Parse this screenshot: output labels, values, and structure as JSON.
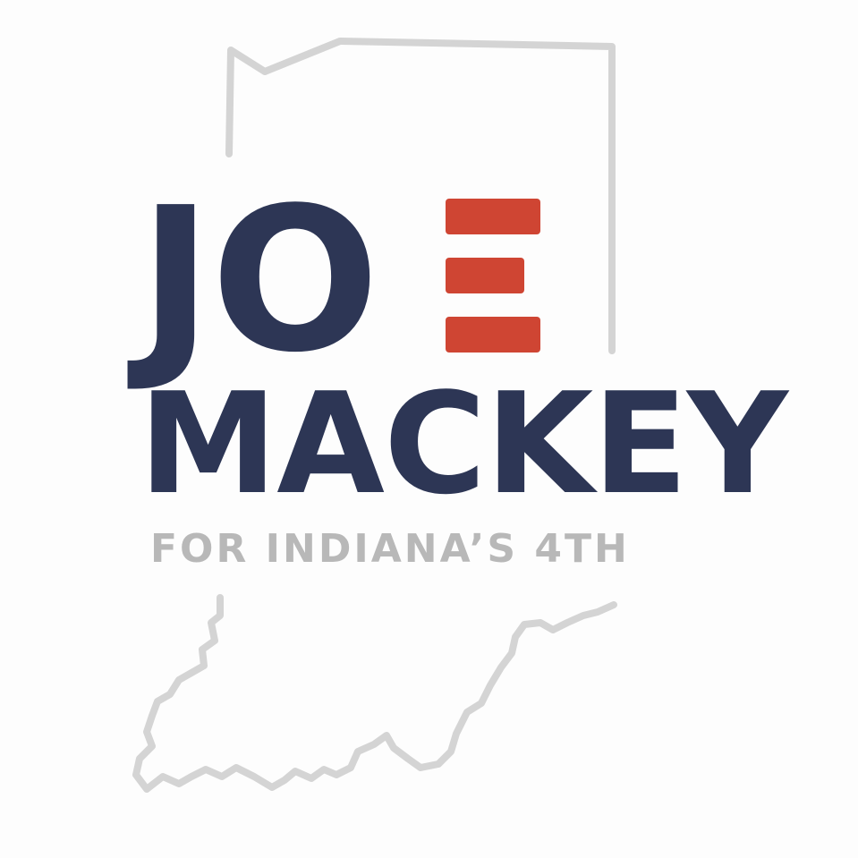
{
  "logo": {
    "first_name_letters": "JO",
    "first_name_full": "JOE",
    "last_name": "MACKEY",
    "tagline": "FOR INDIANA’S 4TH"
  },
  "icons": {
    "state_outline": "indiana-state-outline",
    "e_letter": "three-stripe-e-mark"
  },
  "colors": {
    "navy": "#2d3655",
    "red": "#cf4533",
    "gray_text": "#b8b8b8",
    "outline": "#d4d4d4",
    "background": "#fdfdfd"
  }
}
